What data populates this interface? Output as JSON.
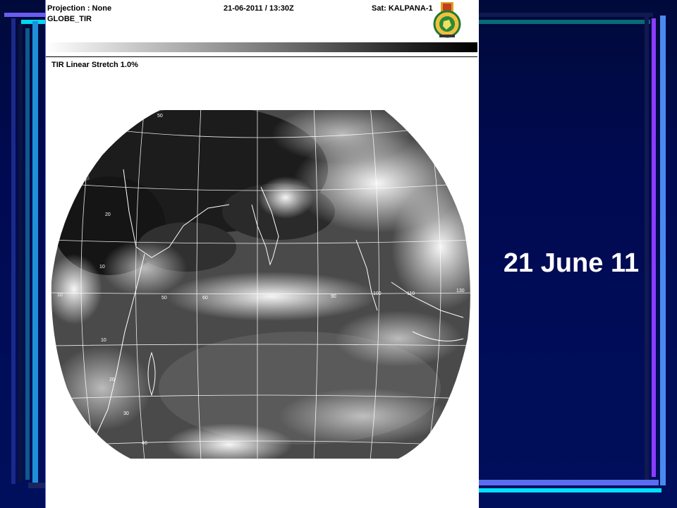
{
  "header": {
    "projection": "Projection : None",
    "product": "GLOBE_TIR",
    "datetime": "21-06-2011 / 13:30Z",
    "satellite": "Sat: KALPANA-1"
  },
  "stretch_label": "TIR Linear Stretch 1.0%",
  "slide_title": "21 June 11",
  "grid_labels": [
    "50",
    "20",
    "10",
    "10",
    "50",
    "60",
    "90",
    "100",
    "110",
    "130",
    "10",
    "20",
    "30",
    "40"
  ],
  "colors": {
    "background": "#000a52",
    "accent_blue": "#5a6cf0",
    "accent_cyan": "#00e0ff",
    "accent_purple": "#8a3cff",
    "accent_teal": "#006a7a"
  },
  "icons": [
    "imd-emblem-icon"
  ]
}
